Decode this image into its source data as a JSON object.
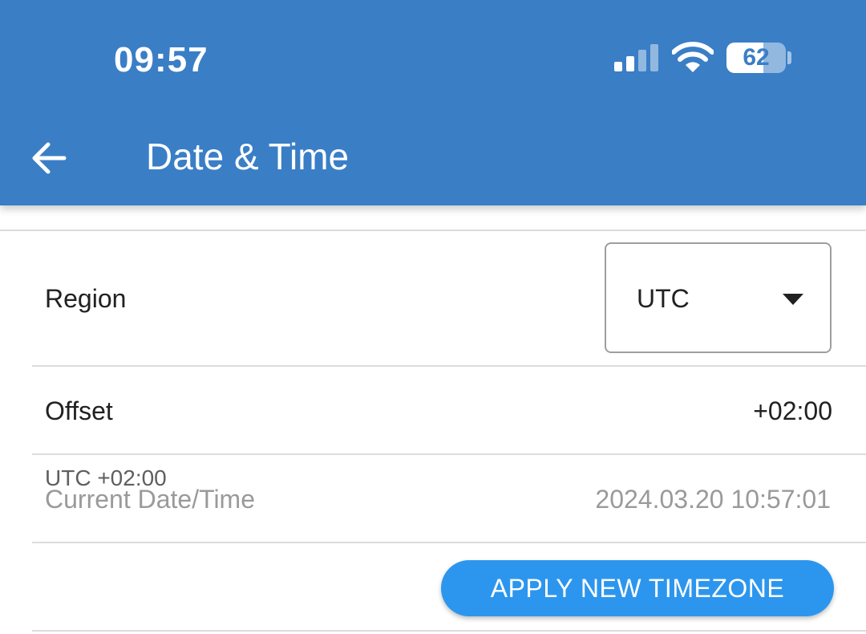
{
  "status_bar": {
    "time": "09:57",
    "battery_percent": "62",
    "battery_level": 0.62,
    "signal_icon": "cellular-signal-icon",
    "wifi_icon": "wifi-icon"
  },
  "app_bar": {
    "title": "Date & Time",
    "back_icon": "arrow-left-icon",
    "color": "#3a7ec6"
  },
  "settings": {
    "region_label": "Region",
    "region_value": "UTC",
    "offset_label": "Offset",
    "offset_value": "+02:00",
    "utc_offset_text": "UTC +02:00",
    "current_label": "Current Date/Time",
    "current_value": "2024.03.20 10:57:01"
  },
  "actions": {
    "apply_label": "APPLY NEW TIMEZONE",
    "apply_color": "#2c96ee"
  }
}
